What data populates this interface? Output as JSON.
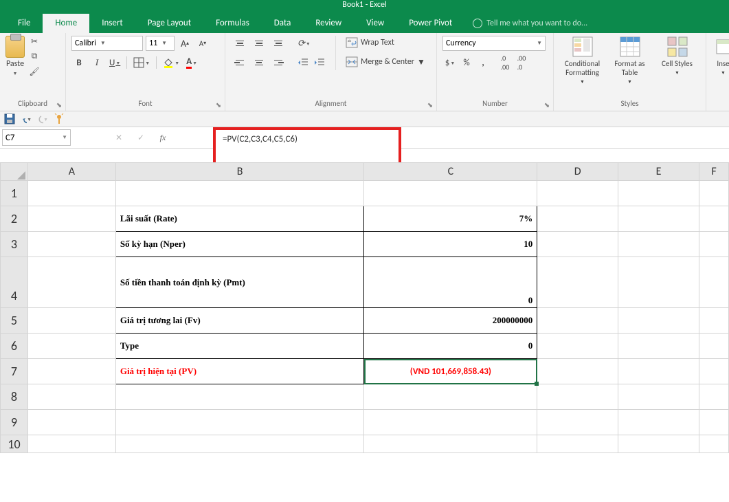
{
  "title": "Book1 - Excel",
  "tabs": {
    "file": "File",
    "home": "Home",
    "insert": "Insert",
    "page_layout": "Page Layout",
    "formulas": "Formulas",
    "data": "Data",
    "review": "Review",
    "view": "View",
    "power_pivot": "Power Pivot"
  },
  "tell_me": "Tell me what you want to do...",
  "ribbon": {
    "clipboard": {
      "label": "Clipboard",
      "paste": "Paste"
    },
    "font": {
      "label": "Font",
      "name": "Calibri",
      "size": "11",
      "bold": "B",
      "italic": "I",
      "underline": "U",
      "inc": "A",
      "dec": "A"
    },
    "alignment": {
      "label": "Alignment",
      "wrap": "Wrap Text",
      "merge": "Merge & Center"
    },
    "number": {
      "label": "Number",
      "format": "Currency",
      "currency": "$",
      "percent": "%",
      "comma": ","
    },
    "styles": {
      "label": "Styles",
      "cond": "Conditional Formatting",
      "fmtas": "Format as Table",
      "cell": "Cell Styles"
    },
    "cells": {
      "label": "",
      "insert": "Inse"
    }
  },
  "name_box": "C7",
  "formula": "=PV(C2,C3,C4,C5,C6)",
  "columns": [
    "A",
    "B",
    "C",
    "D",
    "E",
    "F"
  ],
  "rows_shown": [
    "1",
    "2",
    "3",
    "4",
    "5",
    "6",
    "7",
    "8",
    "9",
    "10"
  ],
  "cells": {
    "b2": "Lãi suất (Rate)",
    "c2": "7%",
    "b3": "Số kỳ hạn (Nper)",
    "c3": "10",
    "b4": "Số tiền thanh toán định kỳ (Pmt)",
    "c4": "0",
    "b5": "Giá trị tương lai (Fv)",
    "c5": "200000000",
    "b6": "Type",
    "c6": "0",
    "b7": "Giá trị hiện tại (PV)",
    "c7": "(VND 101,669,858.43)"
  },
  "chart_data": {
    "type": "table",
    "title": "PV calculation inputs",
    "rows": [
      {
        "label": "Lãi suất (Rate)",
        "value": "7%"
      },
      {
        "label": "Số kỳ hạn (Nper)",
        "value": 10
      },
      {
        "label": "Số tiền thanh toán định kỳ (Pmt)",
        "value": 0
      },
      {
        "label": "Giá trị tương lai (Fv)",
        "value": 200000000
      },
      {
        "label": "Type",
        "value": 0
      },
      {
        "label": "Giá trị hiện tại (PV)",
        "value": "(VND 101,669,858.43)"
      }
    ],
    "formula": "=PV(C2,C3,C4,C5,C6)"
  }
}
